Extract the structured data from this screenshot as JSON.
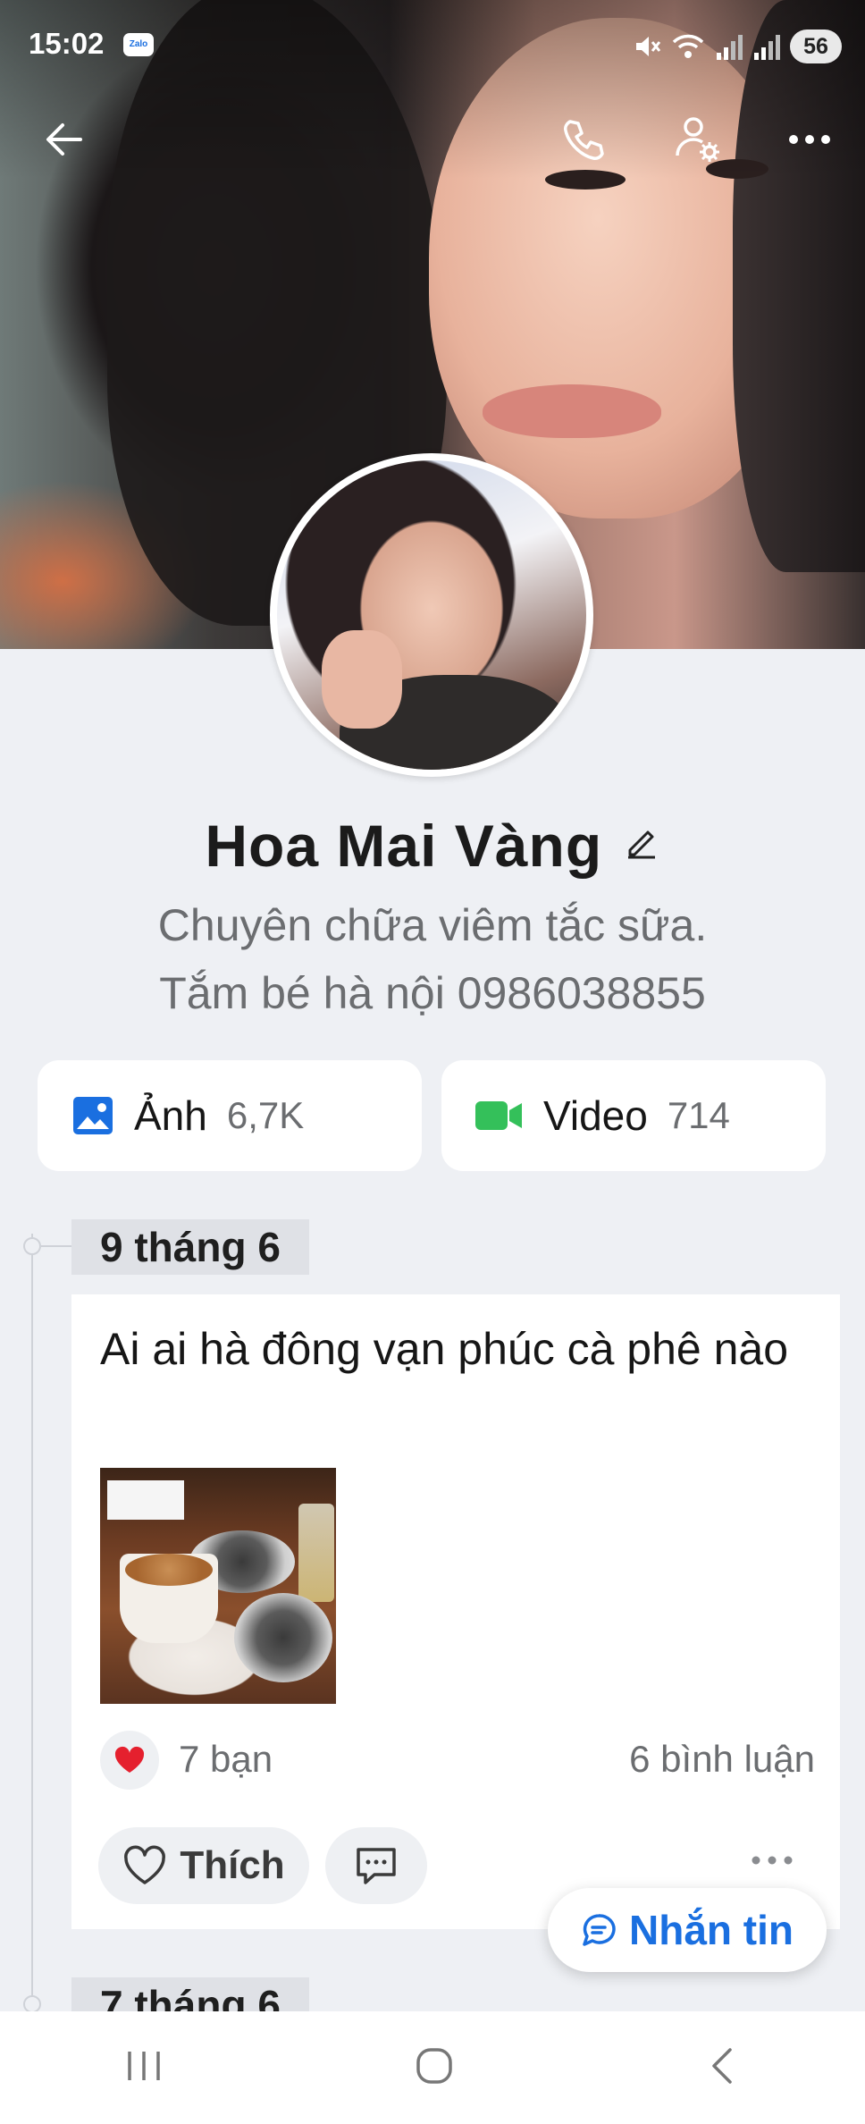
{
  "status_bar": {
    "time": "15:02",
    "app_badge": "Zalo",
    "battery": "56"
  },
  "header": {
    "back_icon": "arrow-left-icon",
    "call_icon": "phone-icon",
    "profile_settings_icon": "user-gear-icon",
    "more_icon": "more-horizontal-icon"
  },
  "profile": {
    "name": "Hoa Mai Vàng",
    "bio_line1": "Chuyên chữa viêm tắc sữa.",
    "bio_line2": "Tắm bé hà nội 0986038855"
  },
  "media": {
    "photos_label": "Ảnh",
    "photos_count": "6,7K",
    "videos_label": "Video",
    "videos_count": "714"
  },
  "timeline": {
    "post1": {
      "date": "9 tháng 6",
      "text": "Ai ai hà đông vạn phúc cà phê nào",
      "reactions": "7 bạn",
      "comments": "6 bình luận",
      "like_label": "Thích"
    },
    "post2": {
      "date": "7 tháng 6"
    }
  },
  "fab": {
    "label": "Nhắn tin"
  },
  "colors": {
    "accent": "#1a6fe0",
    "video_green": "#34c05a",
    "heart_red": "#e5202e"
  }
}
